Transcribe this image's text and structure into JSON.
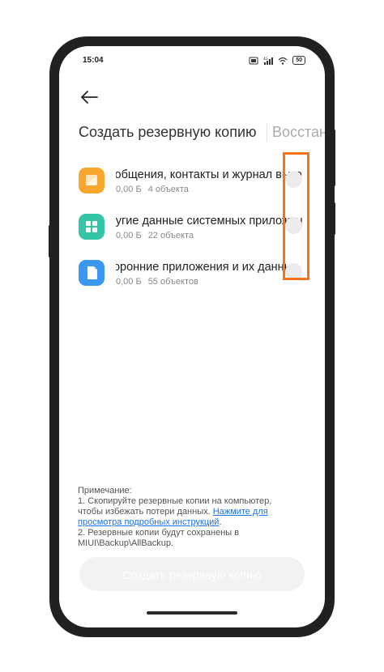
{
  "status": {
    "time": "15:04",
    "signal": "4G",
    "battery": "50"
  },
  "tabs": [
    {
      "label": "Создать резервную копию",
      "active": true
    },
    {
      "label": "Восстановить",
      "active": false
    }
  ],
  "items": [
    {
      "title": "Сообщения, контакты и журнал вызовов",
      "size": "0,00 Б",
      "count": "4 объекта",
      "icon": "message-icon",
      "color": "#f7a72e"
    },
    {
      "title": "Другие данные системных приложений",
      "size": "0,00 Б",
      "count": "22 объекта",
      "icon": "apps-grid-icon",
      "color": "#35c4a7"
    },
    {
      "title": "Сторонние приложения и их данные",
      "size": "0,00 Б",
      "count": "55 объектов",
      "icon": "document-icon",
      "color": "#3a98f3"
    }
  ],
  "note": {
    "title": "Примечание:",
    "line1": "1. Скопируйте резервные копии на компьютер, чтобы избежать потери данных.",
    "link": "Нажмите для просмотра подробных инструкций",
    "line2": "2. Резервные копии будут сохранены в MIUI\\Backup\\AllBackup."
  },
  "cta_label": "Создать резервную копию"
}
